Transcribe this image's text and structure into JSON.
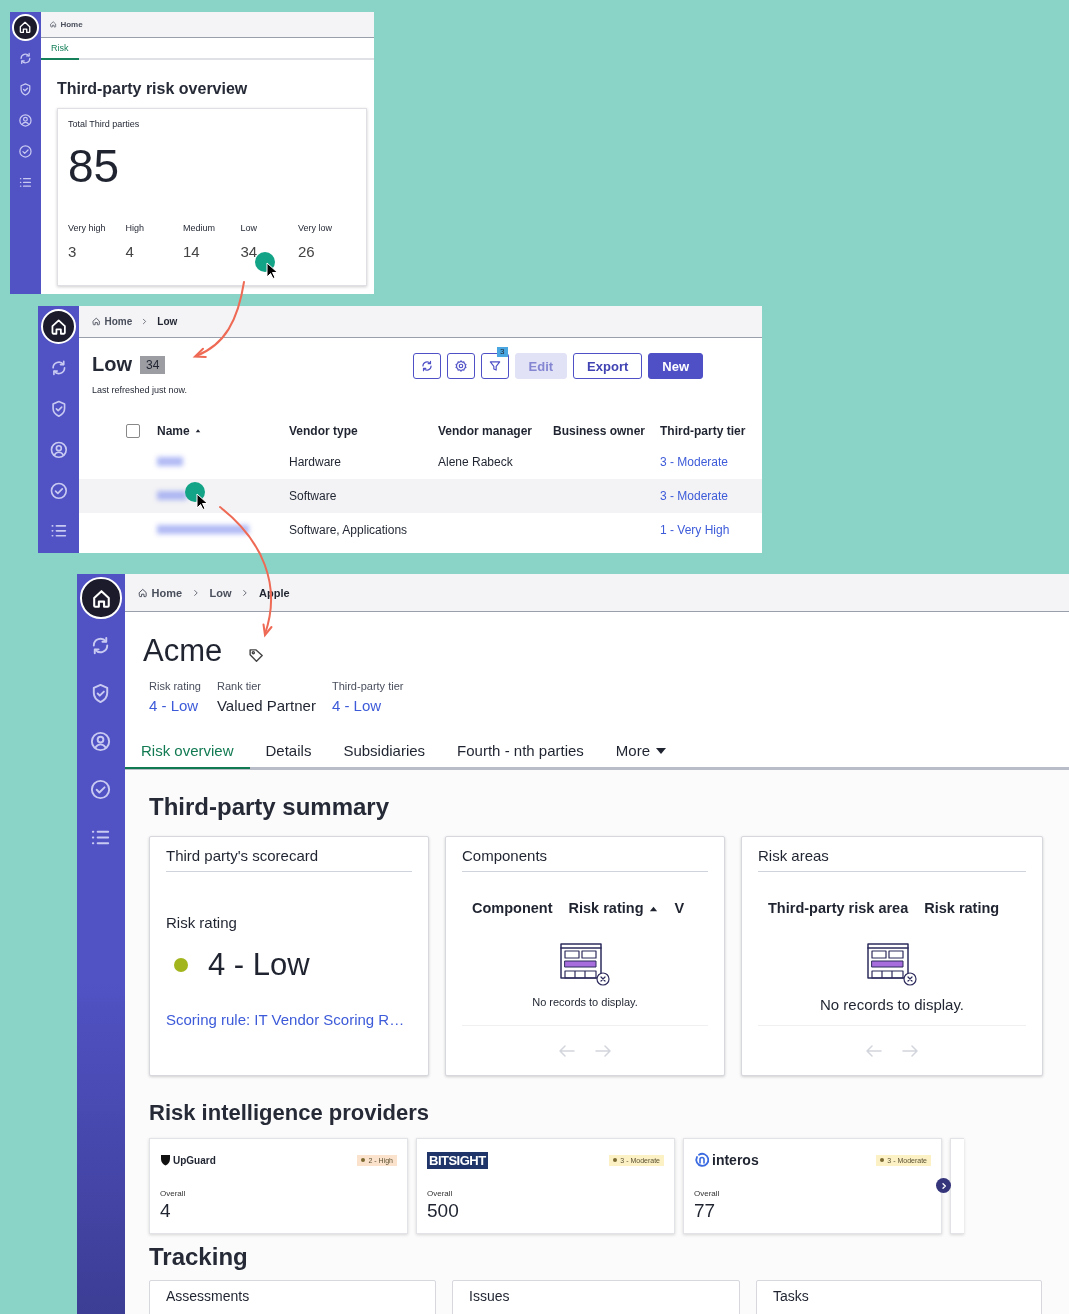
{
  "overview_screen": {
    "sidebar": [
      {
        "kind": "home",
        "selected": true
      },
      {
        "kind": "sync",
        "selected": false
      },
      {
        "kind": "shield",
        "selected": false
      },
      {
        "kind": "user",
        "selected": false
      },
      {
        "kind": "check",
        "selected": false
      },
      {
        "kind": "list",
        "selected": false
      }
    ],
    "breadcrumbs": [
      "Home"
    ],
    "tabs": [
      {
        "label": "Risk",
        "selected": true
      }
    ],
    "title": "Third-party risk overview",
    "total_card": {
      "label": "Total Third parties",
      "value": "85",
      "levels": [
        {
          "label": "Very high",
          "count": "3"
        },
        {
          "label": "High",
          "count": "4"
        },
        {
          "label": "Medium",
          "count": "14"
        },
        {
          "label": "Low",
          "count": "34"
        },
        {
          "label": "Very low",
          "count": "26"
        }
      ]
    }
  },
  "list_screen": {
    "sidebar": [
      {
        "kind": "home",
        "selected": true
      },
      {
        "kind": "sync",
        "selected": false
      },
      {
        "kind": "shield",
        "selected": false
      },
      {
        "kind": "user",
        "selected": false
      },
      {
        "kind": "check",
        "selected": false
      },
      {
        "kind": "list",
        "selected": false
      }
    ],
    "breadcrumbs": [
      "Home",
      "Low"
    ],
    "title": "Low",
    "count": "34",
    "refreshed": "Last refreshed just now.",
    "toolbar": [
      {
        "kind": "refresh"
      },
      {
        "kind": "settings"
      },
      {
        "kind": "filter",
        "badge": "3"
      }
    ],
    "buttons": [
      {
        "label": "Edit",
        "kind": "filled",
        "disabled": true
      },
      {
        "label": "Export",
        "kind": "outline",
        "disabled": false
      },
      {
        "label": "New",
        "kind": "filled",
        "disabled": false
      }
    ],
    "select_all": {
      "checked": false
    },
    "columns": [
      {
        "label": "Name",
        "sort_ascending": true
      },
      {
        "label": "Vendor type"
      },
      {
        "label": "Vendor manager"
      },
      {
        "label": "Business owner"
      },
      {
        "label": "Third-party tier"
      }
    ],
    "rows": [
      {
        "vendor_type": "Hardware",
        "vendor_manager": "Alene Rabeck",
        "tier": "3 - Moderate",
        "hovered": false
      },
      {
        "vendor_type": "Software",
        "tier": "3 - Moderate",
        "hovered": true
      },
      {
        "vendor_type": "Software, Applications",
        "tier": "1 - Very High",
        "hovered": false
      }
    ]
  },
  "detail_screen": {
    "sidebar": [
      {
        "kind": "home",
        "selected": true
      },
      {
        "kind": "sync",
        "selected": false
      },
      {
        "kind": "shield",
        "selected": false
      },
      {
        "kind": "user",
        "selected": false
      },
      {
        "kind": "check",
        "selected": false
      },
      {
        "kind": "list",
        "selected": false
      }
    ],
    "breadcrumbs": [
      "Home",
      "Low",
      "Apple"
    ],
    "title": "Acme",
    "fields": [
      {
        "label": "Risk rating",
        "value": "4 - Low",
        "link": true
      },
      {
        "label": "Rank tier",
        "value": "Valued Partner",
        "link": false
      },
      {
        "label": "Third-party tier",
        "value": "4 - Low",
        "link": true
      }
    ],
    "tabs": [
      {
        "label": "Risk overview",
        "selected": true
      },
      {
        "label": "Details",
        "selected": false
      },
      {
        "label": "Subsidiaries",
        "selected": false
      },
      {
        "label": "Fourth - nth parties",
        "selected": false
      },
      {
        "label": "More",
        "selected": false,
        "kind": "menu"
      }
    ],
    "summary": {
      "title": "Third-party summary",
      "scorecard": {
        "title": "Third party's scorecard",
        "label": "Risk rating",
        "rating": "4 - Low",
        "color": "#a3b51c",
        "link": "Scoring rule: IT Vendor Scoring R…"
      },
      "tables": [
        {
          "title": "Components",
          "columns": [
            {
              "label": "Component"
            },
            {
              "label": "Risk rating",
              "sort_ascending": true
            },
            {
              "label": "V"
            }
          ],
          "empty": "No records to display."
        },
        {
          "title": "Risk areas",
          "columns": [
            {
              "label": "Third-party risk area"
            },
            {
              "label": "Risk rating"
            }
          ],
          "empty": "No records to display."
        }
      ]
    },
    "providers": {
      "title": "Risk intelligence providers",
      "items": [
        {
          "kind": "upguard",
          "name": "UpGuard",
          "badge": "2 - High",
          "color": "#fbe2cc",
          "label": "Overall",
          "score": "4"
        },
        {
          "kind": "bitsight",
          "name": "BITSIGHT",
          "badge": "3 - Moderate",
          "color": "#fbf1c4",
          "label": "Overall",
          "score": "500"
        },
        {
          "kind": "interos",
          "name": "interos",
          "badge": "3 - Moderate",
          "color": "#fbf1c4",
          "label": "Overall",
          "score": "77"
        }
      ]
    },
    "tracking": {
      "title": "Tracking",
      "cards": [
        "Assessments",
        "Issues",
        "Tasks"
      ]
    }
  }
}
